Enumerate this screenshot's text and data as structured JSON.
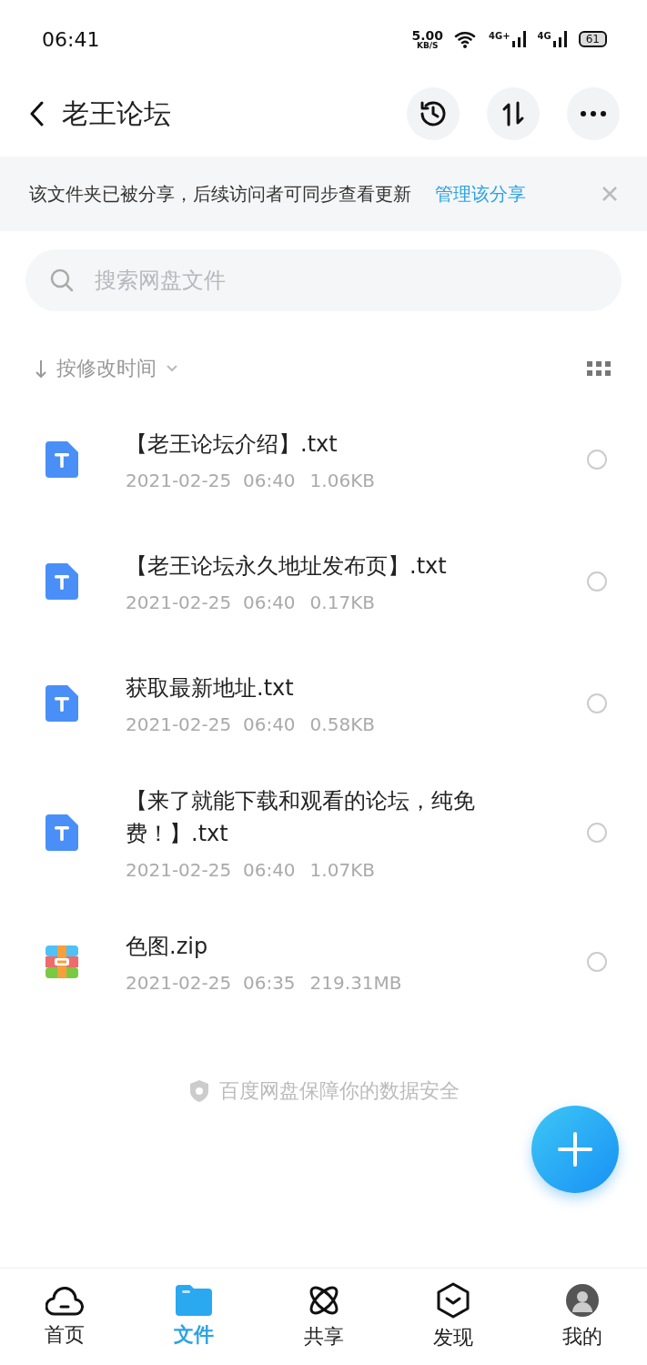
{
  "status_bar": {
    "time": "06:41",
    "speed": "5.00",
    "speed_unit": "KB/S",
    "networks": [
      "4G+",
      "4G"
    ],
    "battery": "61"
  },
  "header": {
    "title": "老王论坛"
  },
  "share_banner": {
    "text": "该文件夹已被分享，后续访问者可同步查看更新",
    "link": "管理该分享"
  },
  "search": {
    "placeholder": "搜索网盘文件"
  },
  "sort": {
    "label": "按修改时间"
  },
  "files": [
    {
      "kind": "text",
      "name": "【老王论坛介绍】.txt",
      "date": "2021-02-25  06:40",
      "size": "1.06KB",
      "selected": false
    },
    {
      "kind": "text",
      "name": "【老王论坛永久地址发布页】.txt",
      "date": "2021-02-25  06:40",
      "size": "0.17KB",
      "selected": false
    },
    {
      "kind": "text",
      "name": "获取最新地址.txt",
      "date": "2021-02-25  06:40",
      "size": "0.58KB",
      "selected": false
    },
    {
      "kind": "text",
      "name": "【来了就能下载和观看的论坛，纯免费！】.txt",
      "date": "2021-02-25  06:40",
      "size": "1.07KB",
      "selected": false
    },
    {
      "kind": "archive",
      "name": "色图.zip",
      "date": "2021-02-25  06:35",
      "size": "219.31MB",
      "selected": false
    }
  ],
  "footer_note": "百度网盘保障你的数据安全",
  "tabs": [
    {
      "kind": "home",
      "label": "首页",
      "selected": false
    },
    {
      "kind": "files",
      "label": "文件",
      "selected": true
    },
    {
      "kind": "share",
      "label": "共享",
      "selected": false
    },
    {
      "kind": "discover",
      "label": "发现",
      "selected": false
    },
    {
      "kind": "me",
      "label": "我的",
      "selected": false
    }
  ]
}
